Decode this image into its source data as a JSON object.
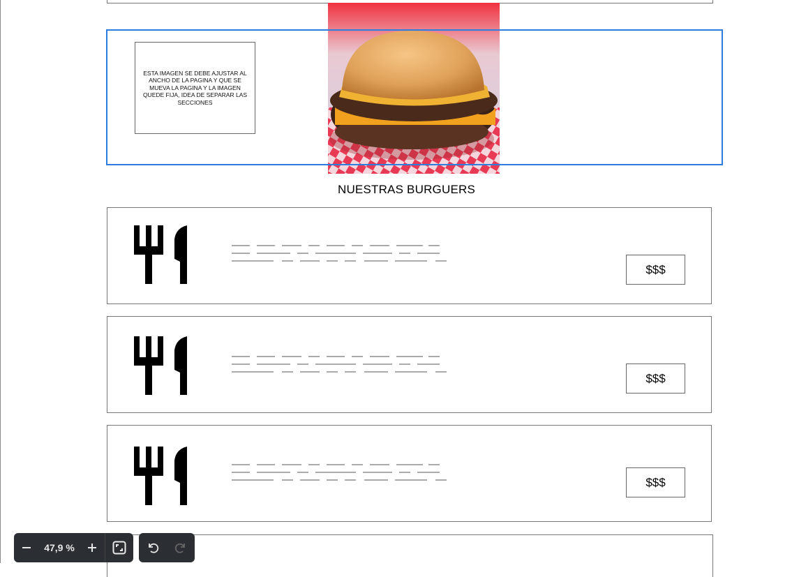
{
  "note": {
    "text": "ESTA IMAGEN SE DEBE AJUSTAR AL ANCHO DE LA PAGINA Y QUE SE MUEVA LA PAGINA Y LA IMAGEN QUEDE FIJA, IDEA DE SEPARAR LAS SECCIONES"
  },
  "section": {
    "title": "NUESTRAS BURGUERS"
  },
  "menu_items": [
    {
      "price": "$$$"
    },
    {
      "price": "$$$"
    },
    {
      "price": "$$$"
    }
  ],
  "toolbar": {
    "zoom_level": "47,9 %",
    "zoom_out_icon": "minus-icon",
    "zoom_in_icon": "plus-icon",
    "fit_icon": "fit-screen-icon",
    "undo_icon": "undo-icon",
    "redo_icon": "redo-icon"
  },
  "colors": {
    "selection": "#2b7de0",
    "toolbar_bg": "#2b2f33",
    "placeholder_text": "#aaaaaa"
  }
}
